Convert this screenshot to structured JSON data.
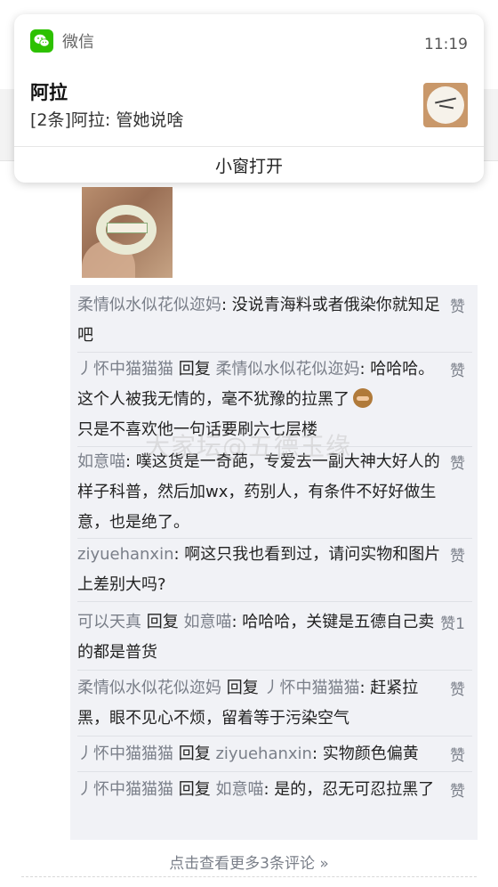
{
  "notification": {
    "app_name": "微信",
    "time": "11:19",
    "title": "阿拉",
    "message": "[2条]阿拉: 管她说啥",
    "open_button": "小窗打开"
  },
  "watermark": "大家坛@五德玉缘",
  "like_label": "赞",
  "comments": [
    {
      "author": "柔情似水似花似迩妈",
      "sep": ": ",
      "text": "没说青海料或者俄染你就知足吧",
      "likes": ""
    },
    {
      "author": "丿怀中猫猫猫",
      "reply": "回复",
      "target": "柔情似水似花似迩妈",
      "sep": ": ",
      "text": "哈哈哈。这个人被我无情的，毫不犹豫的拉黑了",
      "text2": "只是不喜欢他一句话要刷六七层楼",
      "likes": ""
    },
    {
      "author": "如意喵",
      "sep": ": ",
      "text": "噗这货是一奇葩，专爱去一副大神大好人的样子科普，然后加wx，药别人，有条件不好好做生意，也是绝了。",
      "likes": ""
    },
    {
      "author": "ziyuehanxin",
      "sep": ": ",
      "text": "啊这只我也看到过，请问实物和图片上差别大吗?",
      "likes": ""
    },
    {
      "author": "可以天真",
      "reply": "回复",
      "target": "如意喵",
      "sep": ": ",
      "text": "哈哈哈，关键是五德自己卖的都是普货",
      "likes": "1"
    },
    {
      "author": "柔情似水似花似迩妈",
      "reply": "回复",
      "target": "丿怀中猫猫猫",
      "sep": ": ",
      "text": "赶紧拉黑，眼不见心不烦，留着等于污染空气",
      "likes": ""
    },
    {
      "author": "丿怀中猫猫猫",
      "reply": "回复",
      "target": "ziyuehanxin",
      "sep": ": ",
      "text": "实物颜色偏黄",
      "likes": ""
    },
    {
      "author": "丿怀中猫猫猫",
      "reply": "回复",
      "target": "如意喵",
      "sep": ": ",
      "text": "是的，忍无可忍拉黑了",
      "likes": ""
    }
  ],
  "more_comments": "点击查看更多3条评论 »",
  "icons": {
    "app": "wechat-icon",
    "emoji": "see-no-evil-monkey-icon"
  },
  "colors": {
    "wechat_green": "#2dc100",
    "comment_bg": "#f1f2f6",
    "name_gray": "#7a7f89"
  }
}
